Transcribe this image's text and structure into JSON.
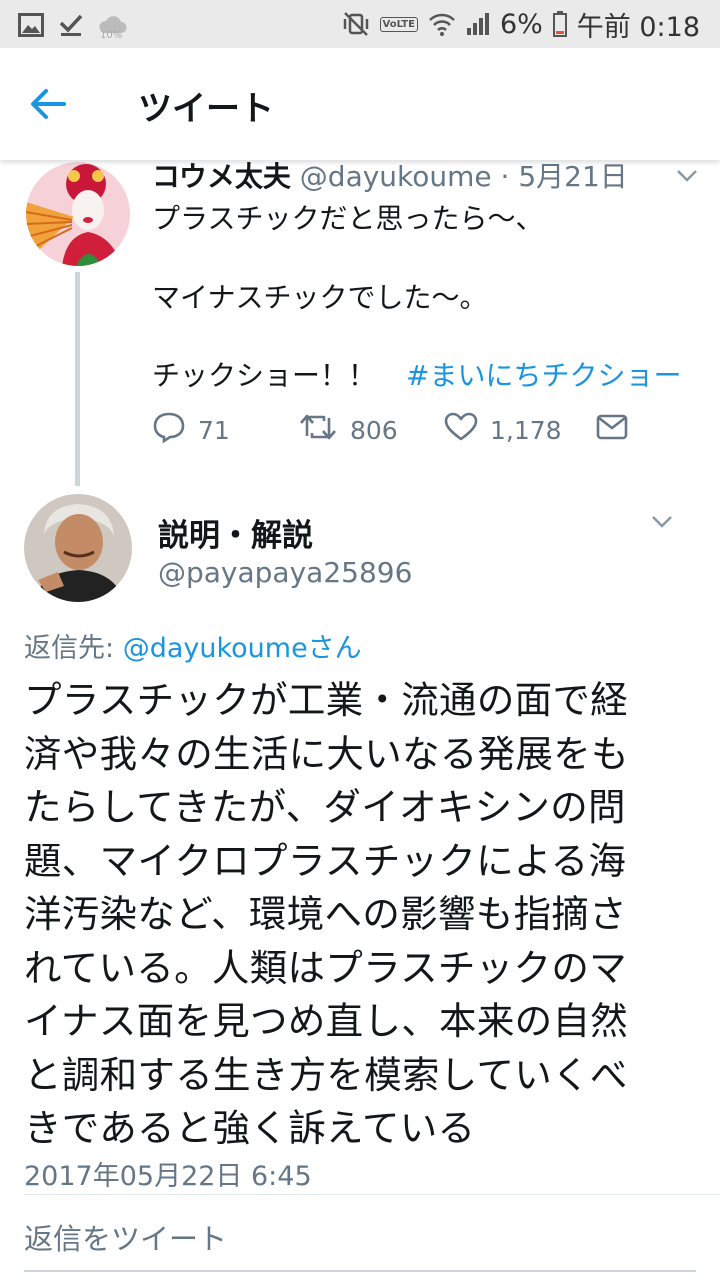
{
  "status_bar": {
    "battery": "6%",
    "time": "午前 0:18",
    "cloud_label": "10%",
    "volte_label": "VoLTE"
  },
  "header": {
    "title": "ツイート"
  },
  "parent_tweet": {
    "name": "コウメ太夫",
    "handle": "@dayukoume",
    "separator": "·",
    "date": "5月21日",
    "lines": [
      "プラスチックだと思ったら〜、",
      "マイナスチックでした〜。",
      "チックショー！！"
    ],
    "hashtag": "#まいにちチクショー",
    "replies": "71",
    "retweets": "806",
    "likes": "1,178"
  },
  "reply_tweet": {
    "name": "説明・解説",
    "handle": "@payapaya25896",
    "reply_to_prefix": "返信先: ",
    "reply_to_mention": "@dayukoumeさん",
    "body_lines": [
      "プラスチックが工業・流通の面で経",
      "済や我々の生活に大いなる発展をも",
      "たらしてきたが、ダイオキシンの問",
      "題、マイクロプラスチックによる海",
      "洋汚染など、環境への影響も指摘さ",
      "れている。人類はプラスチックのマ",
      "イナス面を見つめ直し、本来の自然",
      "と調和する生き方を模索していくべ",
      "きであると強く訴えている"
    ],
    "timestamp": "2017年05月22日 6:45"
  },
  "reply_composer": {
    "placeholder": "返信をツイート"
  },
  "colors": {
    "accent": "#1b95e0",
    "muted": "#657786",
    "text": "#14171a"
  }
}
